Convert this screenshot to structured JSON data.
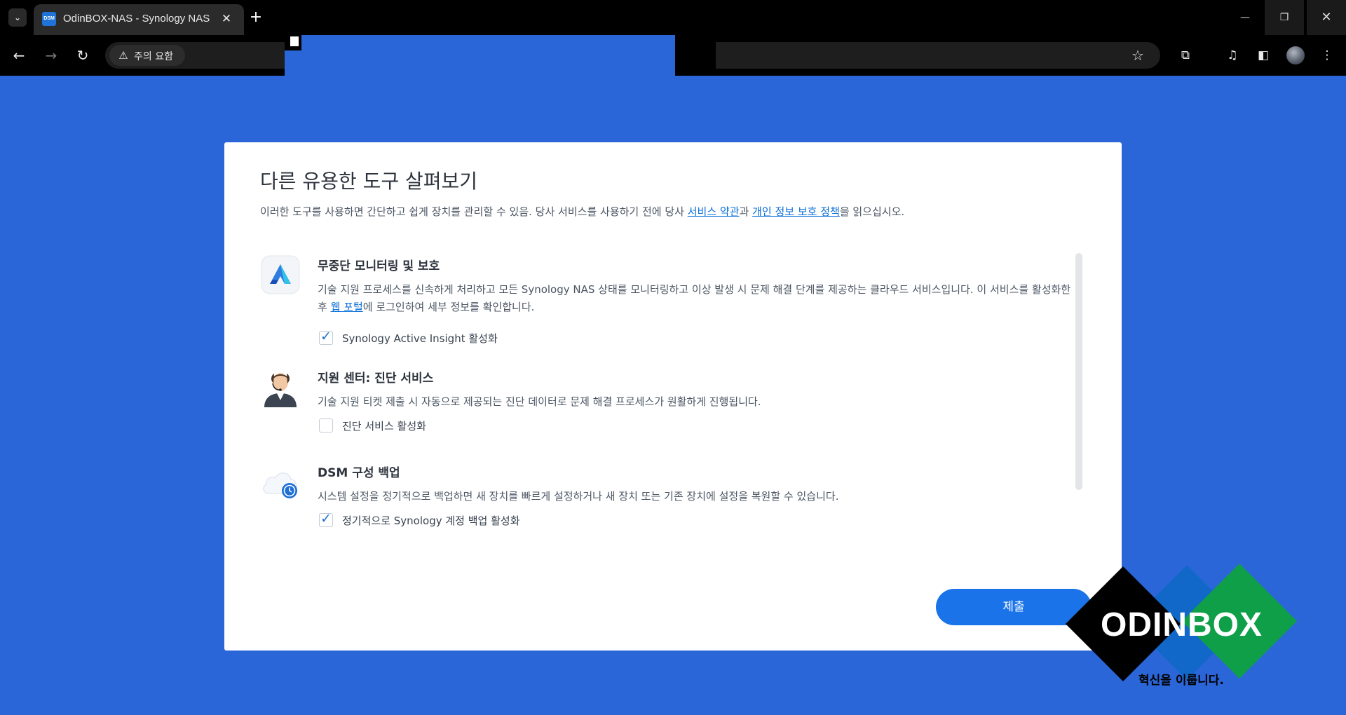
{
  "browser": {
    "tab_title": "OdinBOX-NAS - Synology NAS",
    "tab_favicon_text": "DSM",
    "security_label": "주의 요함",
    "icons": [
      "tab-list-icon",
      "close-icon",
      "new-tab-icon",
      "back-icon",
      "forward-icon",
      "reload-icon",
      "warning-icon",
      "star-icon",
      "extensions-icon",
      "media-icon",
      "side-panel-icon",
      "menu-icon"
    ]
  },
  "dialog": {
    "title": "다른 유용한 도구 살펴보기",
    "desc_before": "이러한 도구를 사용하면 간단하고 쉽게 장치를 관리할 수 있음. 당사 서비스를 사용하기 전에 당사 ",
    "terms_link": "서비스 약관",
    "desc_and": "과 ",
    "privacy_link": "개인 정보 보호 정책",
    "desc_after": "을 읽으십시오.",
    "features": [
      {
        "title": "무중단 모니터링 및 보호",
        "text_before": "기술 지원 프로세스를 신속하게 처리하고 모든 Synology NAS 상태를 모니터링하고 이상 발생 시 문제 해결 단계를 제공하는 클라우드 서비스입니다. 이 서비스를 활성화한 후 ",
        "link": "웹 포털",
        "text_after": "에 로그인하여 세부 정보를 확인합니다.",
        "checkbox_label": "Synology Active Insight 활성화",
        "checked": true
      },
      {
        "title": "지원 센터: 진단 서비스",
        "text": "기술 지원 티켓 제출 시 자동으로 제공되는 진단 데이터로 문제 해결 프로세스가 원활하게 진행됩니다.",
        "checkbox_label": "진단 서비스 활성화",
        "checked": false
      },
      {
        "title": "DSM 구성 백업",
        "text": "시스템 설정을 정기적으로 백업하면 새 장치를 빠르게 설정하거나 새 장치 또는 기존 장치에 설정을 복원할 수 있습니다.",
        "checkbox_label": "정기적으로 Synology 계정 백업 활성화",
        "checked": true
      }
    ],
    "submit_label": "제출",
    "check_glyph": "✓"
  },
  "watermark": {
    "brand": "ODINBOX",
    "slogan": "혁신을 이룹니다."
  },
  "colors": {
    "page_bg": "#2b66d9",
    "accent": "#1a73e8",
    "link": "#0a6fd8",
    "wm_blue": "#1268c9",
    "wm_green": "#0e9f48"
  }
}
